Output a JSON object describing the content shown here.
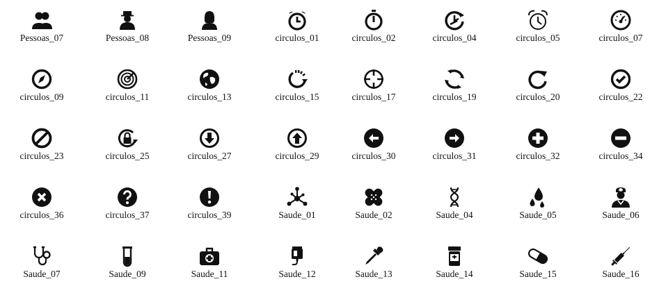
{
  "icons": [
    {
      "label": "Pessoas_07",
      "icon": "people-group-icon"
    },
    {
      "label": "Pessoas_08",
      "icon": "person-hat-icon"
    },
    {
      "label": "Pessoas_09",
      "icon": "person-woman-icon"
    },
    {
      "label": "circulos_01",
      "icon": "alarm-clock-icon"
    },
    {
      "label": "circulos_02",
      "icon": "stopwatch-icon"
    },
    {
      "label": "circulos_04",
      "icon": "clock-arrow-icon"
    },
    {
      "label": "circulos_05",
      "icon": "alarm-clock-outline-icon"
    },
    {
      "label": "circulos_07",
      "icon": "gauge-icon"
    },
    {
      "label": "circulos_09",
      "icon": "compass-icon"
    },
    {
      "label": "circulos_11",
      "icon": "radar-icon"
    },
    {
      "label": "circulos_13",
      "icon": "globe-icon"
    },
    {
      "label": "circulos_15",
      "icon": "loading-arrow-icon"
    },
    {
      "label": "circulos_17",
      "icon": "crosshair-icon"
    },
    {
      "label": "circulos_19",
      "icon": "refresh-cycle-icon"
    },
    {
      "label": "circulos_20",
      "icon": "rotate-arrow-icon"
    },
    {
      "label": "circulos_22",
      "icon": "check-circle-icon"
    },
    {
      "label": "circulos_23",
      "icon": "prohibited-icon"
    },
    {
      "label": "circulos_25",
      "icon": "lock-rotate-icon"
    },
    {
      "label": "circulos_27",
      "icon": "arrow-down-circle-icon"
    },
    {
      "label": "circulos_29",
      "icon": "arrow-up-circle-icon"
    },
    {
      "label": "circulos_30",
      "icon": "arrow-left-circle-icon"
    },
    {
      "label": "circulos_31",
      "icon": "arrow-right-circle-icon"
    },
    {
      "label": "circulos_32",
      "icon": "plus-circle-icon"
    },
    {
      "label": "circulos_34",
      "icon": "minus-circle-icon"
    },
    {
      "label": "circulos_36",
      "icon": "close-circle-icon"
    },
    {
      "label": "circulos_37",
      "icon": "question-circle-icon"
    },
    {
      "label": "circulos_39",
      "icon": "exclamation-circle-icon"
    },
    {
      "label": "Saude_01",
      "icon": "molecule-icon"
    },
    {
      "label": "Saude_02",
      "icon": "bandage-icon"
    },
    {
      "label": "Saude_04",
      "icon": "dna-icon"
    },
    {
      "label": "Saude_05",
      "icon": "drops-icon"
    },
    {
      "label": "Saude_06",
      "icon": "nurse-icon"
    },
    {
      "label": "Saude_07",
      "icon": "stethoscope-icon"
    },
    {
      "label": "Saude_09",
      "icon": "test-tube-icon"
    },
    {
      "label": "Saude_11",
      "icon": "medical-kit-icon"
    },
    {
      "label": "Saude_12",
      "icon": "iv-bag-icon"
    },
    {
      "label": "Saude_13",
      "icon": "dropper-icon"
    },
    {
      "label": "Saude_14",
      "icon": "pill-bottle-icon"
    },
    {
      "label": "Saude_15",
      "icon": "capsule-icon"
    },
    {
      "label": "Saude_16",
      "icon": "syringe-icon"
    }
  ]
}
